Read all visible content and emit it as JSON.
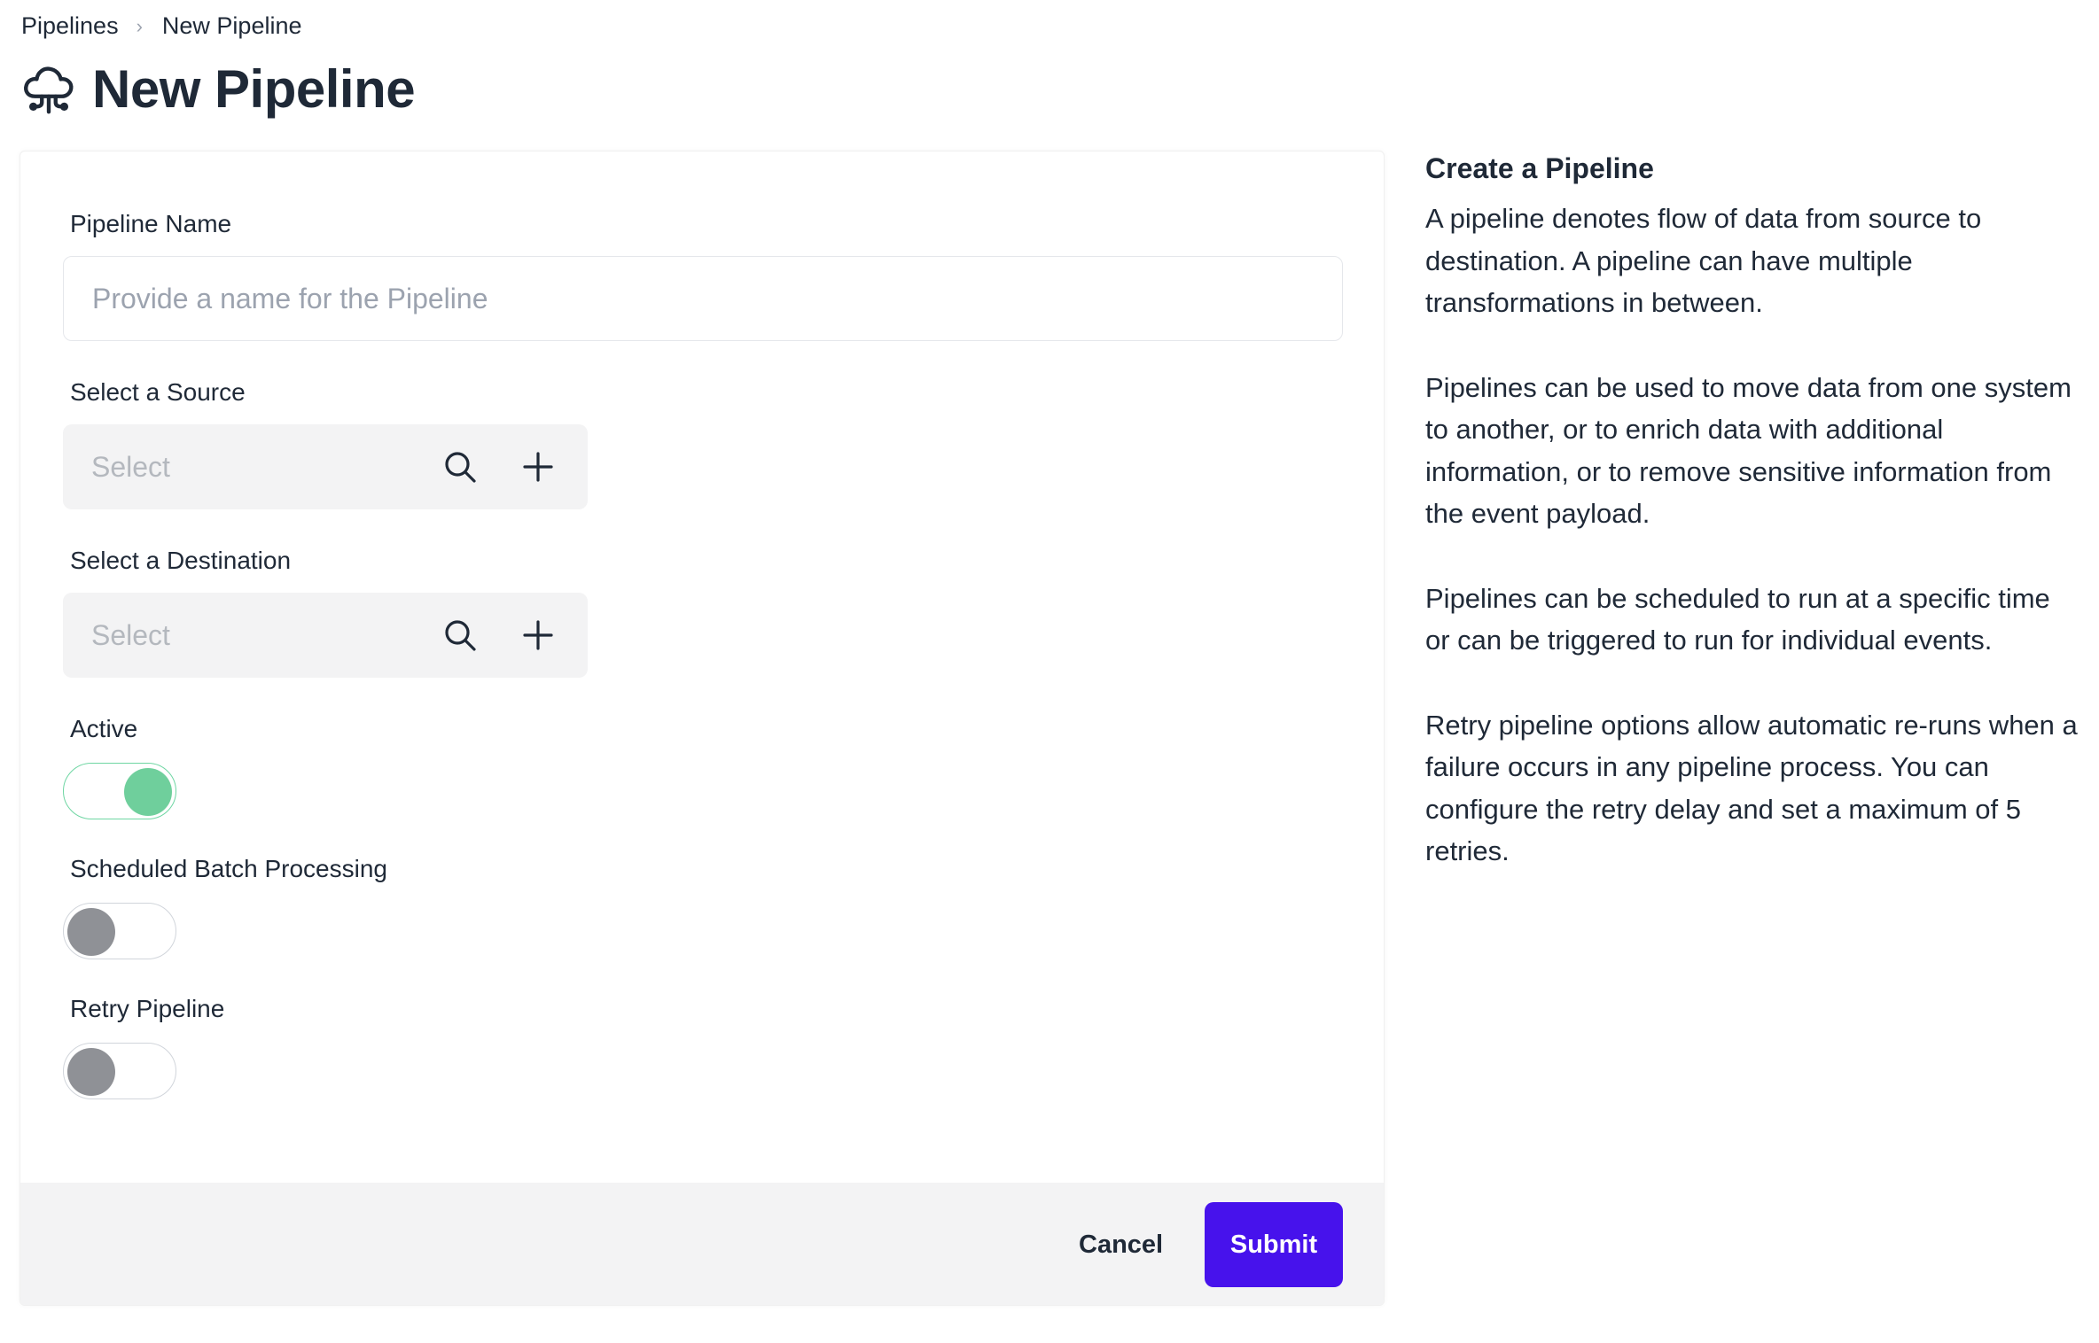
{
  "breadcrumb": {
    "items": [
      "Pipelines",
      "New Pipeline"
    ],
    "separator": "›"
  },
  "header": {
    "title": "New Pipeline",
    "icon": "cloud-pipeline-icon"
  },
  "form": {
    "pipeline_name": {
      "label": "Pipeline Name",
      "value": "",
      "placeholder": "Provide a name for the Pipeline"
    },
    "source": {
      "label": "Select a Source",
      "placeholder": "Select",
      "search_icon": "search-icon",
      "add_icon": "plus-icon"
    },
    "destination": {
      "label": "Select a Destination",
      "placeholder": "Select",
      "search_icon": "search-icon",
      "add_icon": "plus-icon"
    },
    "active": {
      "label": "Active",
      "on": true
    },
    "scheduled_batch": {
      "label": "Scheduled Batch Processing",
      "on": false
    },
    "retry": {
      "label": "Retry Pipeline",
      "on": false
    }
  },
  "footer": {
    "cancel_label": "Cancel",
    "submit_label": "Submit"
  },
  "help": {
    "title": "Create a Pipeline",
    "paragraphs": [
      "A pipeline denotes flow of data from source to destination. A pipeline can have multiple transformations in between.",
      "Pipelines can be used to move data from one system to another, or to enrich data with additional information, or to remove sensitive information from the event payload.",
      "Pipelines can be scheduled to run at a specific time or can be triggered to run for individual events.",
      "Retry pipeline options allow automatic re-runs when a failure occurs in any pipeline process. You can configure the retry delay and set a maximum of 5 retries."
    ]
  },
  "colors": {
    "accent": "#4712ec",
    "toggle_on": "#6fcf9c",
    "toggle_off": "#8f9196",
    "text": "#1f2937",
    "placeholder": "#9ca3af",
    "panel_gray": "#f3f3f4"
  }
}
